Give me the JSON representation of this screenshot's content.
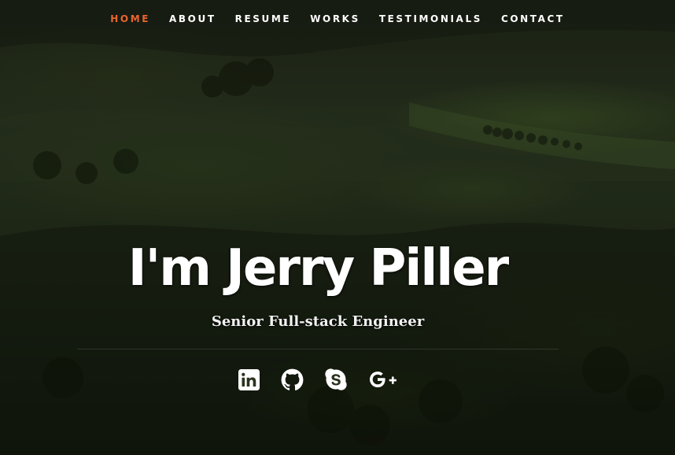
{
  "nav": {
    "items": [
      {
        "label": "HOME",
        "active": true
      },
      {
        "label": "ABOUT",
        "active": false
      },
      {
        "label": "RESUME",
        "active": false
      },
      {
        "label": "WORKS",
        "active": false
      },
      {
        "label": "TESTIMONIALS",
        "active": false
      },
      {
        "label": "CONTACT",
        "active": false
      }
    ],
    "active_color": "#e8652e",
    "text_color": "#ffffff"
  },
  "banner": {
    "title": "I'm Jerry Piller",
    "subtitle": "Senior Full-stack Engineer"
  },
  "social": [
    {
      "icon": "linkedin-icon",
      "name": "LinkedIn"
    },
    {
      "icon": "github-icon",
      "name": "GitHub"
    },
    {
      "icon": "skype-icon",
      "name": "Skype"
    },
    {
      "icon": "google-plus-icon",
      "name": "Google+"
    }
  ],
  "background": {
    "description_color": "#1c2414"
  }
}
